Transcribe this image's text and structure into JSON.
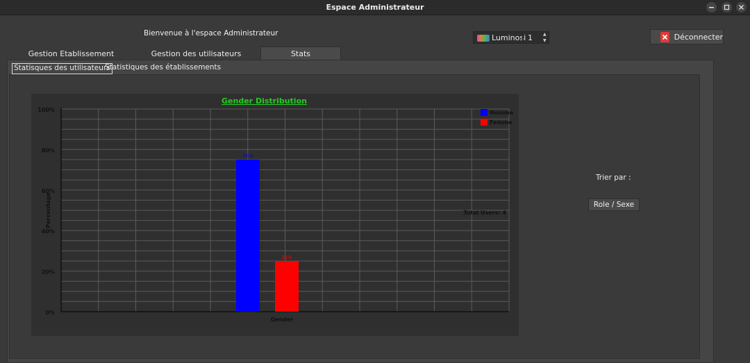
{
  "window": {
    "title": "Espace Administrateur"
  },
  "header": {
    "welcome": "Bienvenue à l'espace Administrateur",
    "luminosity": {
      "label": "Luminosi",
      "value": "1",
      "icon": "palette-icon"
    },
    "disconnect_label": "Déconnecter"
  },
  "tabs": [
    {
      "label": "Gestion Etablissement"
    },
    {
      "label": "Gestion des utilisateurs"
    },
    {
      "label": "Stats",
      "active": true
    }
  ],
  "subtabs": [
    {
      "label": "Statisques des utilisateurs",
      "active": true
    },
    {
      "label": "Statistiques des établissements"
    }
  ],
  "side": {
    "sort_label": "Trier par :",
    "sort_button": "Role / Sexe"
  },
  "chart_data": {
    "type": "bar",
    "title": "Gender Distribution",
    "xlabel": "Gender",
    "ylabel": "Percentage",
    "ylim": [
      0,
      100
    ],
    "yticks": [
      "0%",
      "20%",
      "40%",
      "60%",
      "80%",
      "100%"
    ],
    "grid": true,
    "legend_position": "top-right",
    "annotation": "Total Users: 4",
    "title_color": "#22cc22",
    "series": [
      {
        "name": "Homme",
        "value": 75,
        "label": "75%",
        "color": "#0000ff"
      },
      {
        "name": "Femme",
        "value": 25,
        "label": "25%",
        "color": "#ff0000"
      }
    ]
  }
}
